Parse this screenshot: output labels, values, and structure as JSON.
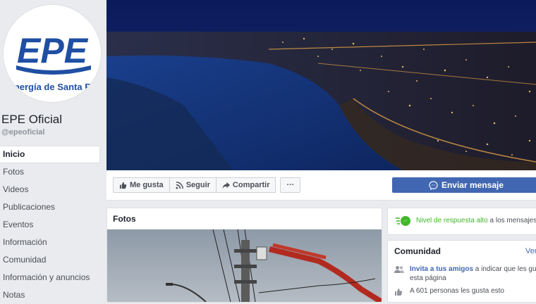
{
  "page": {
    "logo_text": "EPE",
    "logo_subtitle": "nergía de Santa F",
    "name": "EPE Oficial",
    "handle": "@epeoficial"
  },
  "nav": [
    {
      "label": "Inicio",
      "active": true
    },
    {
      "label": "Fotos"
    },
    {
      "label": "Videos"
    },
    {
      "label": "Publicaciones"
    },
    {
      "label": "Eventos"
    },
    {
      "label": "Información"
    },
    {
      "label": "Comunidad"
    },
    {
      "label": "Información y anuncios"
    },
    {
      "label": "Notas"
    }
  ],
  "actions": {
    "like": "Me gusta",
    "follow": "Seguir",
    "share": "Compartir",
    "more": "···",
    "send_message": "Enviar mensaje"
  },
  "photos": {
    "title": "Fotos"
  },
  "response": {
    "highlight": "Nivel de respuesta alto",
    "rest": " a los mensajes"
  },
  "community": {
    "title": "Comunidad",
    "see_all": "Ver",
    "invite_link": "Invita a tus amigos",
    "invite_rest": " a indicar que les gusta esta página",
    "likes": "A 601 personas les gusta esto"
  },
  "colors": {
    "brand_blue": "#4267b2",
    "epe_blue": "#1f4fa3",
    "response_green": "#42b72a"
  }
}
